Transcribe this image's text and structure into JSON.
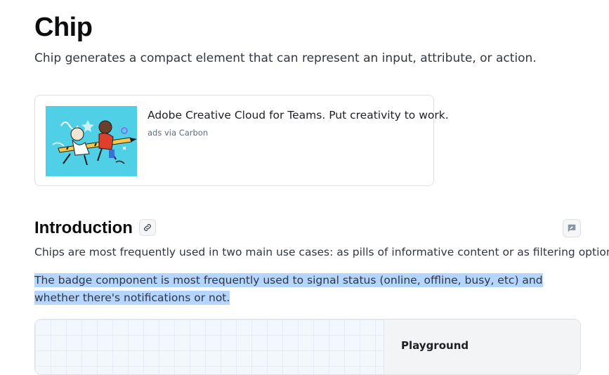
{
  "page": {
    "title": "Chip",
    "lead": "Chip generates a compact element that can represent an input, attribute, or action."
  },
  "ad": {
    "text": "Adobe Creative Cloud for Teams. Put creativity to work.",
    "via": "ads via Carbon",
    "image_icon": "illustration-image"
  },
  "introduction": {
    "title": "Introduction",
    "anchor_icon": "link-icon",
    "feedback_icon": "feedback-icon",
    "paragraph_1": "Chips are most frequently used in two main use cases: as pills of informative content or as filtering options.",
    "paragraph_2": "The badge component is most frequently used to signal status (online, offline, busy, etc) and whether there's notifications or not."
  },
  "demo": {
    "playground_label": "Playground"
  },
  "colors": {
    "selection": "#b4d5fe",
    "ad_image_bg": "#4fd0e6"
  }
}
